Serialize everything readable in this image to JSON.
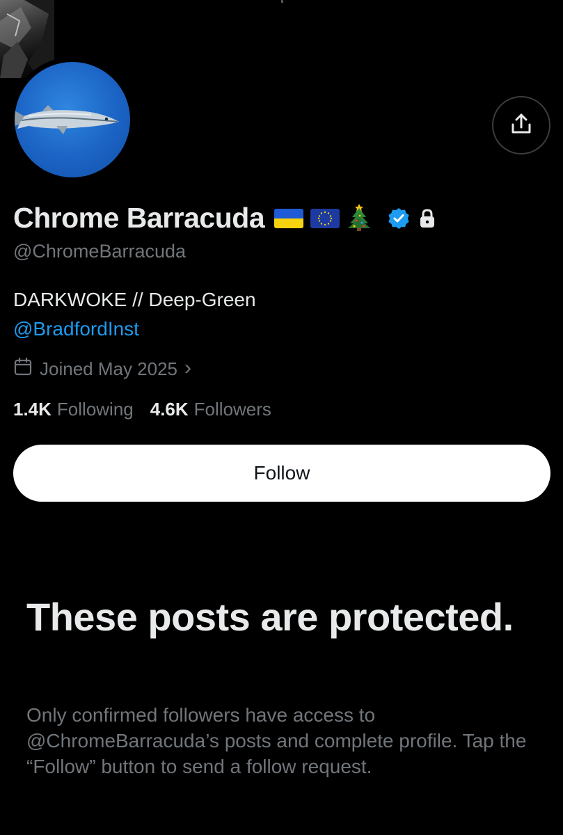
{
  "profile": {
    "display_name": "Chrome Barracuda",
    "handle": "@ChromeBarracuda",
    "bio": "DARKWOKE // Deep-Green",
    "bio_link": "@BradfordInst",
    "joined": "Joined May 2025",
    "joined_chevron": "›",
    "following_count": "1.4K",
    "following_label": "Following",
    "followers_count": "4.6K",
    "followers_label": "Followers",
    "badges": [
      "ukraine-flag-emoji",
      "eu-flag-emoji",
      "christmas-tree-emoji",
      "verified-badge-icon",
      "lock-icon"
    ]
  },
  "actions": {
    "follow_label": "Follow",
    "share_icon": "share-icon"
  },
  "protected_notice": {
    "title": "These posts are protected.",
    "description": "Only confirmed followers have access to @ChromeBarracuda’s posts and complete profile. Tap the “Follow” button to send a follow request."
  },
  "colors": {
    "background": "#000000",
    "text_primary": "#e7e9ea",
    "text_secondary": "#71767b",
    "link": "#1d9bf0",
    "verified": "#1d9bf0",
    "follow_button_bg": "#ffffff"
  }
}
